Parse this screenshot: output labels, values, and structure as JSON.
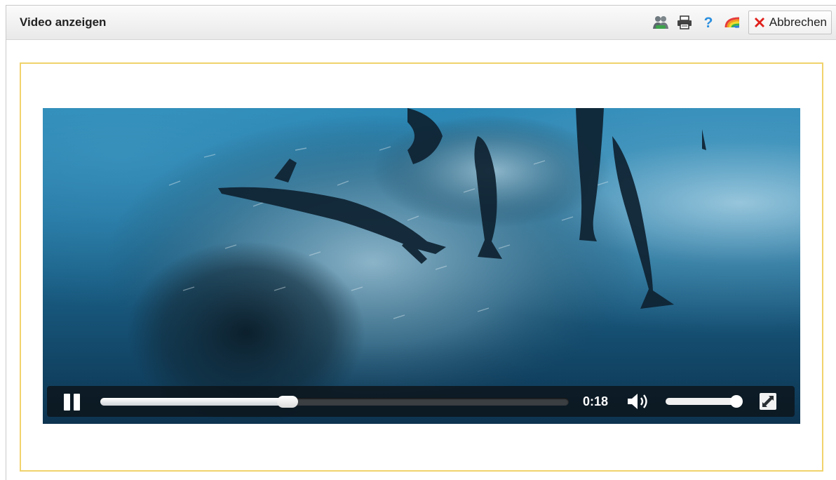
{
  "window": {
    "title": "Video anzeigen"
  },
  "toolbar": {
    "icons": [
      "users-icon",
      "print-icon",
      "help-icon",
      "rainbow-icon"
    ],
    "cancel_label": "Abbrechen"
  },
  "video": {
    "time": "0:18",
    "progress": 0.4,
    "volume": 1.0
  },
  "colors": {
    "frame_border": "#f0d36c",
    "cancel_x": "#e0201b",
    "help": "#2b8fdf"
  }
}
